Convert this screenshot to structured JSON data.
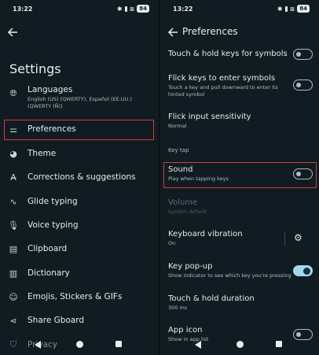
{
  "left": {
    "status": {
      "time": "13:22",
      "battery": "84"
    },
    "title": "Settings",
    "items": [
      {
        "label": "Languages",
        "sub": "English (US) (QWERTY), Español (EE.UU.) (QWERTY (Ñ))",
        "icon": "globe-icon"
      },
      {
        "label": "Preferences",
        "icon": "sliders-icon"
      },
      {
        "label": "Theme",
        "icon": "palette-icon"
      },
      {
        "label": "Corrections & suggestions",
        "icon": "text-correction-icon"
      },
      {
        "label": "Glide typing",
        "icon": "glide-typing-icon"
      },
      {
        "label": "Voice typing",
        "icon": "microphone-icon"
      },
      {
        "label": "Clipboard",
        "icon": "clipboard-icon"
      },
      {
        "label": "Dictionary",
        "icon": "book-icon"
      },
      {
        "label": "Emojis, Stickers & GIFs",
        "icon": "emoji-icon"
      },
      {
        "label": "Share Gboard",
        "icon": "share-icon"
      },
      {
        "label": "Privacy",
        "icon": "shield-icon"
      }
    ]
  },
  "right": {
    "status": {
      "time": "13:22",
      "battery": "84"
    },
    "title": "Preferences",
    "items": [
      {
        "title": "Touch & hold keys for symbols",
        "toggle": false
      },
      {
        "title": "Flick keys to enter symbols",
        "sub": "Touch a key and pull downward to enter its hinted symbol",
        "toggle": false
      },
      {
        "title": "Flick input sensitivity",
        "sub": "Normal"
      },
      {
        "title": "Sound",
        "sub": "Play when tapping keys",
        "toggle": false
      },
      {
        "title": "Volume",
        "sub": "System default",
        "disabled": true
      },
      {
        "title": "Keyboard vibration",
        "sub": "On"
      },
      {
        "title": "Key pop-up",
        "sub": "Show indicator to see which key you're pressing",
        "toggle": true
      },
      {
        "title": "Touch & hold duration",
        "sub": "300 ms"
      },
      {
        "title": "App icon",
        "sub": "Show in app list",
        "toggle": false
      }
    ],
    "section_key_tap": "Key tap"
  },
  "colors": {
    "background": "#101c21",
    "accent": "#a6d6ec",
    "highlight": "#d83a3a"
  }
}
